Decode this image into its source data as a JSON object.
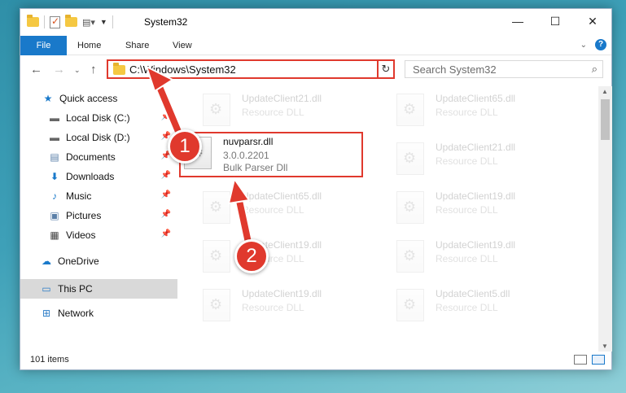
{
  "window": {
    "title": "System32",
    "controls": {
      "minimize": "—",
      "maximize": "☐",
      "close": "✕"
    }
  },
  "ribbon": {
    "tabs": [
      "File",
      "Home",
      "Share",
      "View"
    ]
  },
  "address": {
    "path": "C:\\Windows\\System32",
    "search_placeholder": "Search System32"
  },
  "sidebar": {
    "items": [
      {
        "label": "Quick access",
        "icon": "star-icon",
        "pinned": false
      },
      {
        "label": "Local Disk (C:)",
        "icon": "drive-icon",
        "pinned": true
      },
      {
        "label": "Local Disk (D:)",
        "icon": "drive-icon",
        "pinned": true
      },
      {
        "label": "Documents",
        "icon": "documents-icon",
        "pinned": true
      },
      {
        "label": "Downloads",
        "icon": "download-icon",
        "pinned": true
      },
      {
        "label": "Music",
        "icon": "music-icon",
        "pinned": true
      },
      {
        "label": "Pictures",
        "icon": "pictures-icon",
        "pinned": true
      },
      {
        "label": "Videos",
        "icon": "videos-icon",
        "pinned": true
      },
      {
        "label": "OneDrive",
        "icon": "cloud-icon",
        "pinned": false
      },
      {
        "label": "This PC",
        "icon": "pc-icon",
        "pinned": false,
        "selected": true
      },
      {
        "label": "Network",
        "icon": "network-icon",
        "pinned": false
      }
    ]
  },
  "files": [
    {
      "name": "UpdateClient21.dll",
      "type": "Resource DLL"
    },
    {
      "name": "UpdateClient65.dll",
      "type": "Resource DLL"
    },
    {
      "name": "nuvparsr.dll",
      "version": "3.0.0.2201",
      "type": "Bulk Parser Dll"
    },
    {
      "name": "UpdateClient21.dll",
      "type": "Resource DLL"
    },
    {
      "name": "UpdateClient65.dll",
      "type": "Resource DLL"
    },
    {
      "name": "UpdateClient19.dll",
      "type": "Resource DLL"
    },
    {
      "name": "UpdateClient19.dll",
      "type": "Resource DLL"
    },
    {
      "name": "UpdateClient19.dll",
      "type": "Resource DLL"
    },
    {
      "name": "UpdateClient19.dll",
      "type": "Resource DLL"
    },
    {
      "name": "UpdateClient5.dll",
      "type": "Resource DLL"
    }
  ],
  "status": {
    "item_count": "101 items"
  },
  "annotations": {
    "step1": "1",
    "step2": "2"
  },
  "colors": {
    "accent": "#1979ca",
    "highlight": "#e0392d"
  }
}
